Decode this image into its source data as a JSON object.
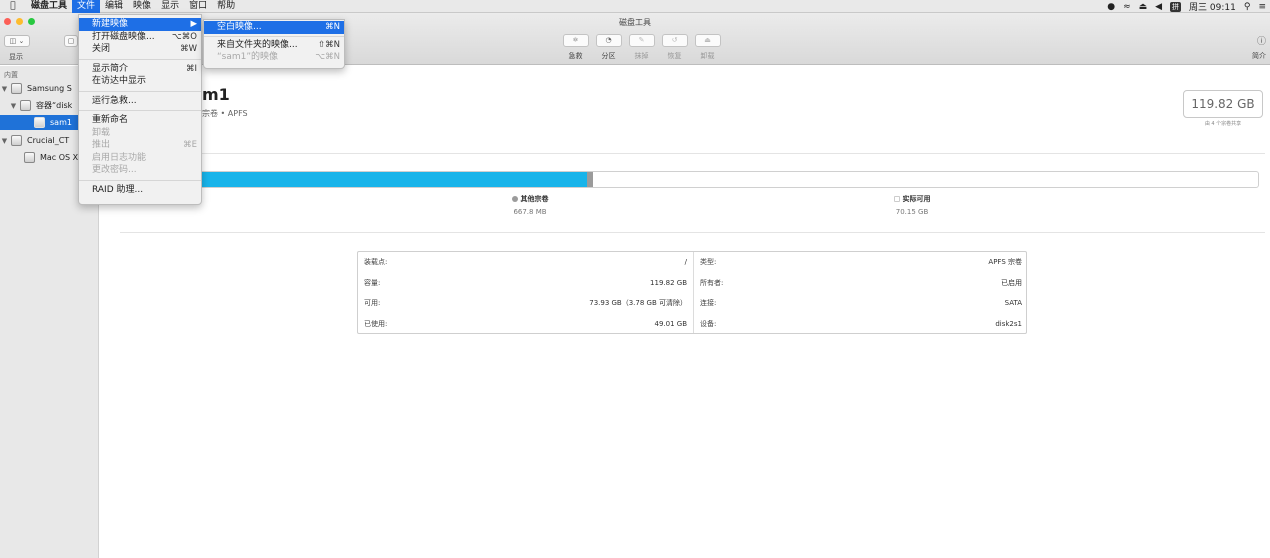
{
  "menubar": {
    "apple": "",
    "items": [
      "磁盘工具",
      "文件",
      "编辑",
      "映像",
      "显示",
      "窗口",
      "帮助"
    ],
    "clock": "周三 09:11",
    "ime": "拼"
  },
  "window": {
    "title": "磁盘工具",
    "view_label": "显示",
    "toolbar": [
      {
        "label": "急救",
        "icon": "stethoscope-icon"
      },
      {
        "label": "分区",
        "icon": "pie-icon"
      },
      {
        "label": "抹掉",
        "icon": "erase-icon"
      },
      {
        "label": "恢复",
        "icon": "restore-icon"
      },
      {
        "label": "卸载",
        "icon": "eject-icon"
      }
    ],
    "info_label": "简介"
  },
  "sidebar": {
    "section": "内置",
    "items": [
      "Samsung S",
      "容器“disk",
      "sam1",
      "Crucial_CT",
      "Mac OS X"
    ]
  },
  "volume": {
    "name": "m1",
    "subtitle": "宗卷 • APFS",
    "capacity": "119.82 GB",
    "capacity_sub": "由 4 个宗卷共享",
    "used_fraction": 0.41,
    "other_fraction": 0.005,
    "legend": [
      {
        "name": "其他宗卷",
        "value": "667.8 MB",
        "color": "#9b9b9b"
      },
      {
        "name": "实际可用",
        "value": "70.15 GB",
        "color": "#ffffff"
      }
    ]
  },
  "info": {
    "left": [
      {
        "k": "装载点:",
        "v": "/"
      },
      {
        "k": "容量:",
        "v": "119.82 GB"
      },
      {
        "k": "可用:",
        "v": "73.93 GB（3.78 GB 可清除）"
      },
      {
        "k": "已使用:",
        "v": "49.01 GB"
      }
    ],
    "right": [
      {
        "k": "类型:",
        "v": "APFS 宗卷"
      },
      {
        "k": "所有者:",
        "v": "已启用"
      },
      {
        "k": "连接:",
        "v": "SATA"
      },
      {
        "k": "设备:",
        "v": "disk2s1"
      }
    ]
  },
  "file_menu": {
    "new_image": "新建映像",
    "open_image": "打开磁盘映像...",
    "open_image_sc": "⌥⌘O",
    "close": "关闭",
    "close_sc": "⌘W",
    "get_info": "显示简介",
    "get_info_sc": "⌘I",
    "show_in_finder": "在访达中显示",
    "first_aid": "运行急救...",
    "rename": "重新命名",
    "unmount": "卸载",
    "eject": "推出",
    "eject_sc": "⌘E",
    "journaling": "启用日志功能",
    "change_password": "更改密码...",
    "raid": "RAID 助理..."
  },
  "submenu": {
    "blank": "空白映像...",
    "blank_sc": "⌘N",
    "from_folder": "来自文件夹的映像...",
    "from_folder_sc": "⇧⌘N",
    "from_sam1": "“sam1”的映像",
    "from_sam1_sc": "⌥⌘N"
  }
}
